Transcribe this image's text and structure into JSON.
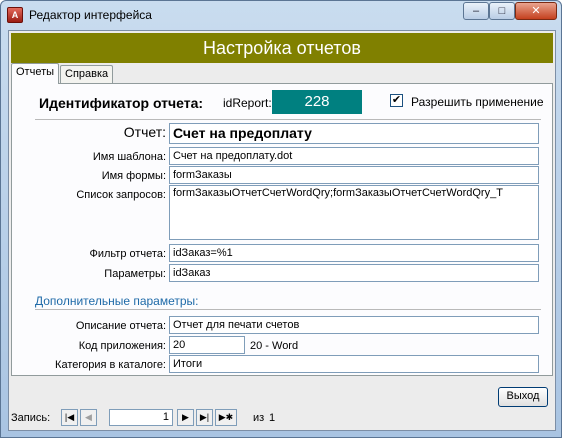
{
  "window": {
    "title": "Редактор интерфейса",
    "app_icon_label": "A",
    "min": "–",
    "max": "□",
    "close": "✕"
  },
  "form": {
    "header": "Настройка отчетов"
  },
  "tabs": [
    {
      "label": "Отчеты"
    },
    {
      "label": "Справка"
    }
  ],
  "report": {
    "id_caption": "Идентификатор отчета:",
    "id_label": "idReport:",
    "id_value": "228",
    "allow_checked": "✔",
    "allow_label": "Разрешить применение",
    "report_label": "Отчет:",
    "report_value": "Счет на предоплату",
    "template_label": "Имя шаблона:",
    "template_value": "Счет на предоплату.dot",
    "form_label": "Имя формы:",
    "form_value": "formЗаказы",
    "queries_label": "Список запросов:",
    "queries_value": "formЗаказыОтчетСчетWordQry;formЗаказыОтчетСчетWordQry_T",
    "filter_label": "Фильтр отчета:",
    "filter_value": "idЗаказ=%1",
    "params_label": "Параметры:",
    "params_value": "idЗаказ",
    "extra_section": "Дополнительные параметры:",
    "description_label": "Описание отчета:",
    "description_value": "Отчет для печати счетов",
    "app_code_label": "Код приложения:",
    "app_code_value": "20",
    "app_code_text": "20 - Word",
    "category_label": "Категория в каталоге:",
    "category_value": "Итоги"
  },
  "buttons": {
    "exit": "Выход"
  },
  "navigator": {
    "label": "Запись:",
    "first": "|◀",
    "prev": "◀",
    "current": "1",
    "next": "▶",
    "last": "▶|",
    "new": "▶✱",
    "of_label": "из",
    "total": "1"
  }
}
